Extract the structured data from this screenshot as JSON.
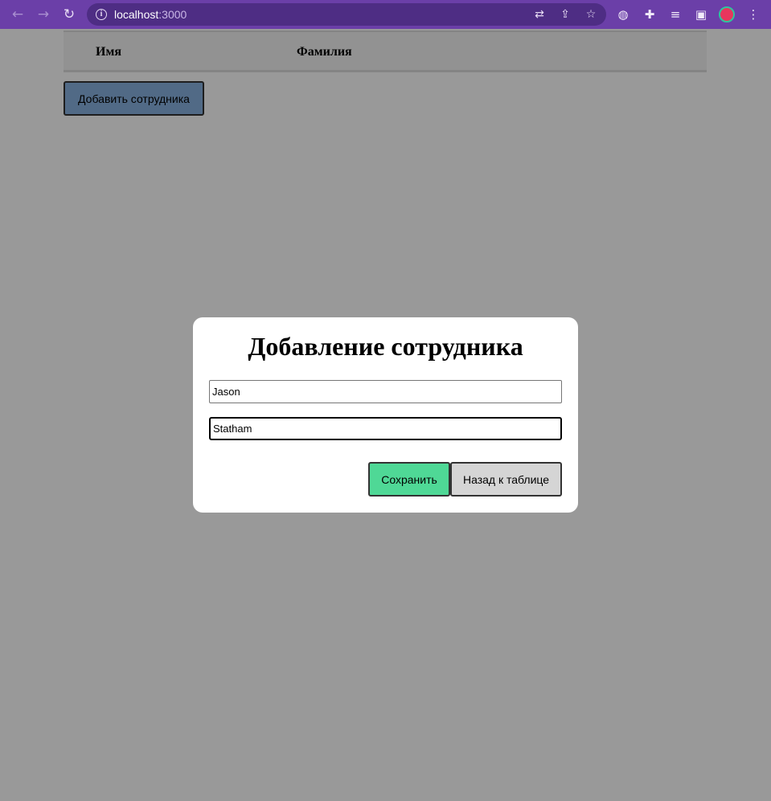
{
  "browser": {
    "url_host": "localhost",
    "url_port": ":3000",
    "icons": [
      "back-icon",
      "forward-icon",
      "reload-icon",
      "site-info-icon",
      "translate-icon",
      "share-icon",
      "bookmark-star-icon",
      "globe-extension-icon",
      "extensions-puzzle-icon",
      "media-queue-icon",
      "side-panel-icon",
      "profile-avatar",
      "menu-kebab-icon"
    ]
  },
  "table": {
    "columns": [
      "Имя",
      "Фамилия"
    ]
  },
  "add_button_label": "Добавить сотрудника",
  "modal": {
    "title": "Добавление сотрудника",
    "first_name_value": "Jason",
    "last_name_value": "Statham",
    "save_label": "Сохранить",
    "back_label": "Назад к таблице"
  },
  "colors": {
    "browser_chrome": "#6b3fa8",
    "add_button": "#87b1e0",
    "save_button": "#4fd896",
    "back_button": "#d5d5d5",
    "overlay": "rgba(0,0,0,0.4)"
  }
}
